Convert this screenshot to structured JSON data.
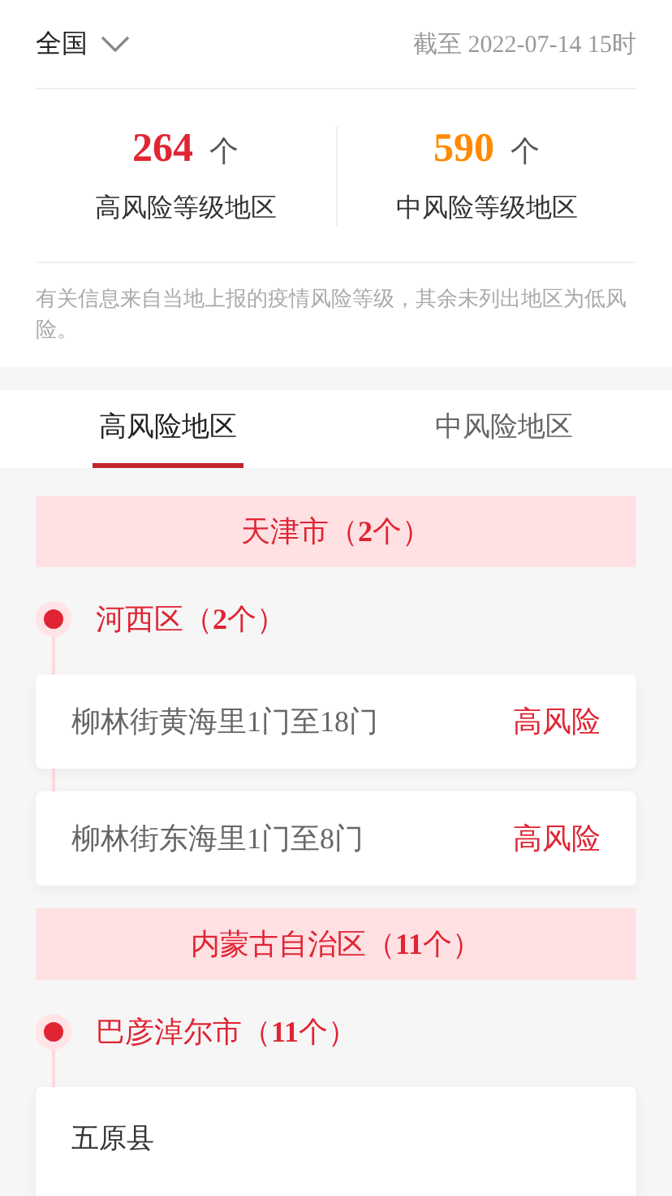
{
  "header": {
    "region": "全国",
    "updated": "截至 2022-07-14 15时"
  },
  "stats": [
    {
      "count": "264",
      "unit": "个",
      "label": "高风险等级地区",
      "color": "#e02433"
    },
    {
      "count": "590",
      "unit": "个",
      "label": "中风险等级地区",
      "color": "#ff8a00"
    }
  ],
  "note": "有关信息来自当地上报的疫情风险等级，其余未列出地区为低风险。",
  "tabs": [
    {
      "label": "高风险地区",
      "selected": true
    },
    {
      "label": "中风险地区",
      "selected": false
    }
  ],
  "provinces": [
    {
      "title": "天津市（**2**个）",
      "districts": [
        {
          "title": "河西区（**2**个）",
          "areas": [
            {
              "name": "柳林街黄海里1门至18门",
              "risk": "高风险"
            },
            {
              "name": "柳林街东海里1门至8门",
              "risk": "高风险"
            }
          ]
        }
      ]
    },
    {
      "title": "内蒙古自治区（**11**个）",
      "districts": [
        {
          "title": "巴彦淖尔市（**11**个）",
          "areas": [
            {
              "name": "五原县"
            }
          ]
        }
      ]
    }
  ]
}
